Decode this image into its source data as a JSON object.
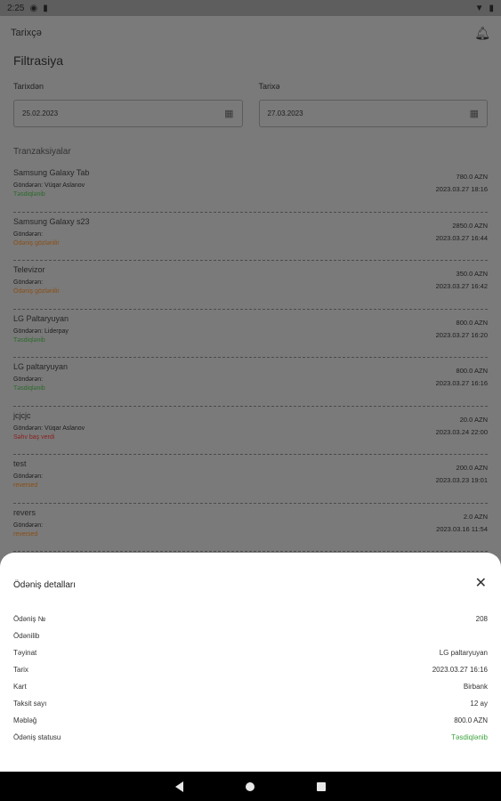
{
  "status_bar": {
    "time": "2:25",
    "icons": [
      "shield-icon",
      "sd-card-icon"
    ],
    "right_icons": [
      "wifi-icon",
      "battery-icon"
    ]
  },
  "topbar": {
    "title": "Tarixçə",
    "icon": "bell-icon"
  },
  "filter": {
    "title": "Filtrasiya",
    "from_label": "Tarixdən",
    "from_value": "25.02.2023",
    "to_label": "Tarixə",
    "to_value": "27.03.2023"
  },
  "transactions_title": "Tranzaksiyalar",
  "transactions": [
    {
      "name": "Samsung Galaxy Tab",
      "sender": "Göndərən: Vüqar Aslanov",
      "status": "Təsdiqlənib",
      "status_color": "green",
      "amount": "780.0 AZN",
      "date": "2023.03.27 18:16"
    },
    {
      "name": "Samsung Galaxy s23",
      "sender": "Göndərən:",
      "status": "Ödəniş gözlənilir",
      "status_color": "orange",
      "amount": "2850.0 AZN",
      "date": "2023.03.27 16:44"
    },
    {
      "name": "Televizor",
      "sender": "Göndərən:",
      "status": "Ödəniş gözlənilir",
      "status_color": "orange",
      "amount": "350.0 AZN",
      "date": "2023.03.27 16:42"
    },
    {
      "name": "LG Paltaryuyan",
      "sender": "Göndərən: Liderpay",
      "status": "Təsdiqlənib",
      "status_color": "green",
      "amount": "800.0 AZN",
      "date": "2023.03.27 16:20"
    },
    {
      "name": "LG paltaryuyan",
      "sender": "Göndərən:",
      "status": "Təsdiqlənib",
      "status_color": "green",
      "amount": "800.0 AZN",
      "date": "2023.03.27 16:16"
    },
    {
      "name": "jcjcjc",
      "sender": "Göndərən: Vüqar Aslanov",
      "status": "Səhv baş verdi",
      "status_color": "red",
      "amount": "20.0 AZN",
      "date": "2023.03.24 22:00"
    },
    {
      "name": "test",
      "sender": "Göndərən:",
      "status": "reversed",
      "status_color": "orange",
      "amount": "200.0 AZN",
      "date": "2023.03.23 19:01"
    },
    {
      "name": "revers",
      "sender": "Göndərən:",
      "status": "reversed",
      "status_color": "orange",
      "amount": "2.0 AZN",
      "date": "2023.03.16 11:54"
    }
  ],
  "sheet": {
    "title": "Ödəniş detalları",
    "rows": [
      {
        "label": "Ödəniş №",
        "value": "208"
      },
      {
        "label": "Ödənilib",
        "value": ""
      },
      {
        "label": "Təyinat",
        "value": "LG paltaryuyan"
      },
      {
        "label": "Tarix",
        "value": "2023.03.27 16:16"
      },
      {
        "label": "Kart",
        "value": "Birbank"
      },
      {
        "label": "Taksit sayı",
        "value": "12 ay"
      },
      {
        "label": "Məbləğ",
        "value": "800.0 AZN"
      },
      {
        "label": "Ödəniş statusu",
        "value": "Təsdiqlənib"
      }
    ]
  },
  "colors": {
    "status_green": "#3fa33f",
    "overlay": "#7a7a7a",
    "sheet_bg": "#ffffff"
  }
}
